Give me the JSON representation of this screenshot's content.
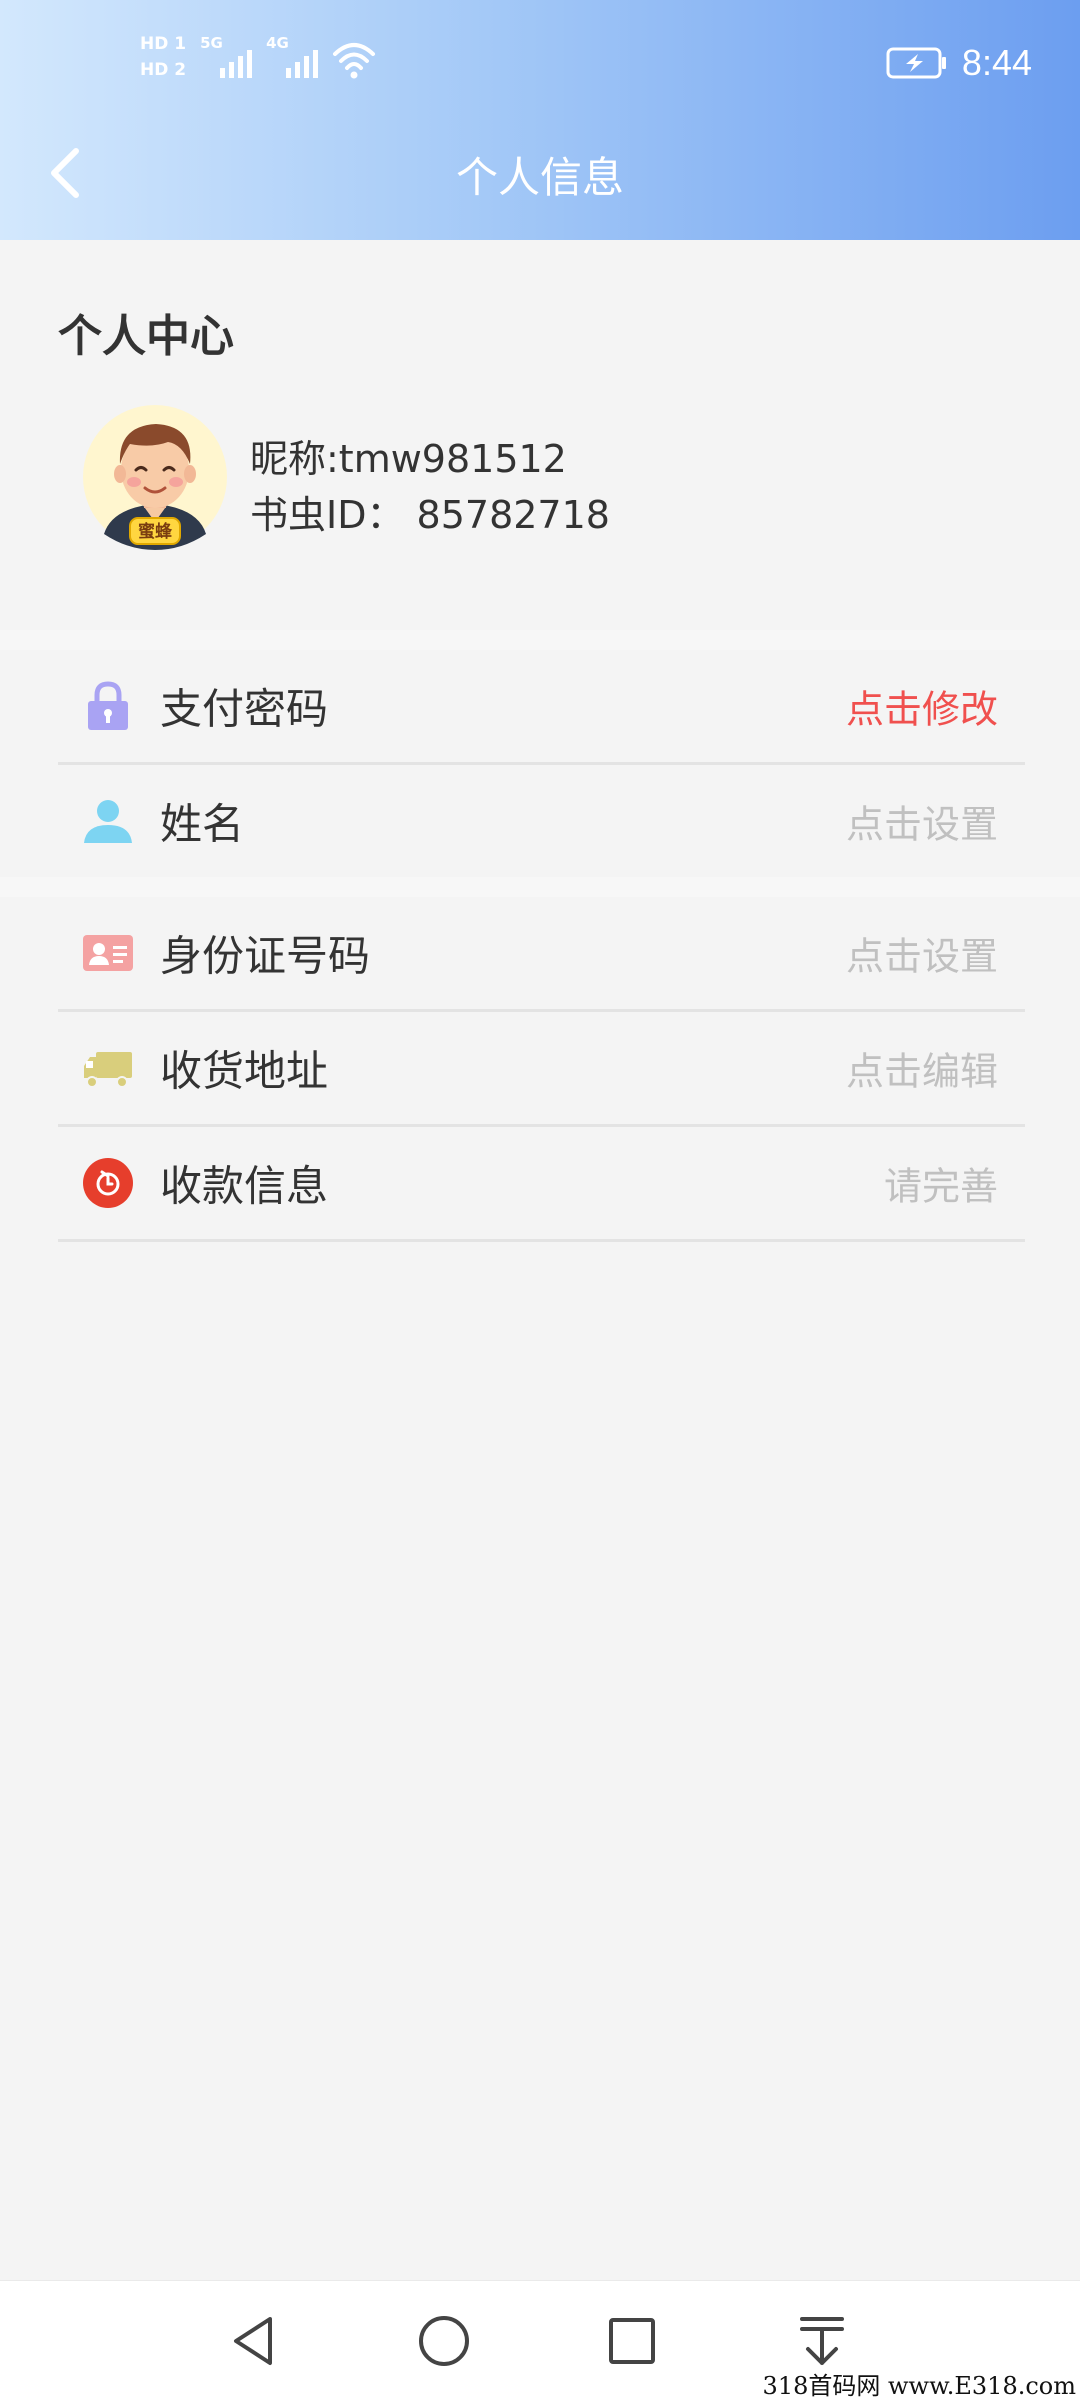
{
  "statusbar": {
    "hd1": "HD 1",
    "hd2": "HD 2",
    "sim1_type": "5G",
    "sim2_type": "4G",
    "time": "8:44"
  },
  "header": {
    "title": "个人信息"
  },
  "profile": {
    "section_title": "个人中心",
    "nickname": "昵称:tmw981512",
    "user_id": "书虫ID：  85782718",
    "avatar_badge": "蜜蜂"
  },
  "rows": [
    {
      "label": "支付密码",
      "action": "点击修改",
      "icon": "lock-icon",
      "color": "#a9a3f3"
    },
    {
      "label": "姓名",
      "action": "点击设置",
      "icon": "person-icon",
      "color": "#7dd4f2"
    },
    {
      "label": "身份证号码",
      "action": "点击设置",
      "icon": "id-card-icon",
      "color": "#f4a2a2"
    },
    {
      "label": "收货地址",
      "action": "点击编辑",
      "icon": "truck-icon",
      "color": "#d9ce7c"
    },
    {
      "label": "收款信息",
      "action": "请完善",
      "icon": "payment-icon",
      "color": "#e63e2c"
    }
  ],
  "accent_red": "#f0504e",
  "watermark": "318首码网  www.E318.com"
}
